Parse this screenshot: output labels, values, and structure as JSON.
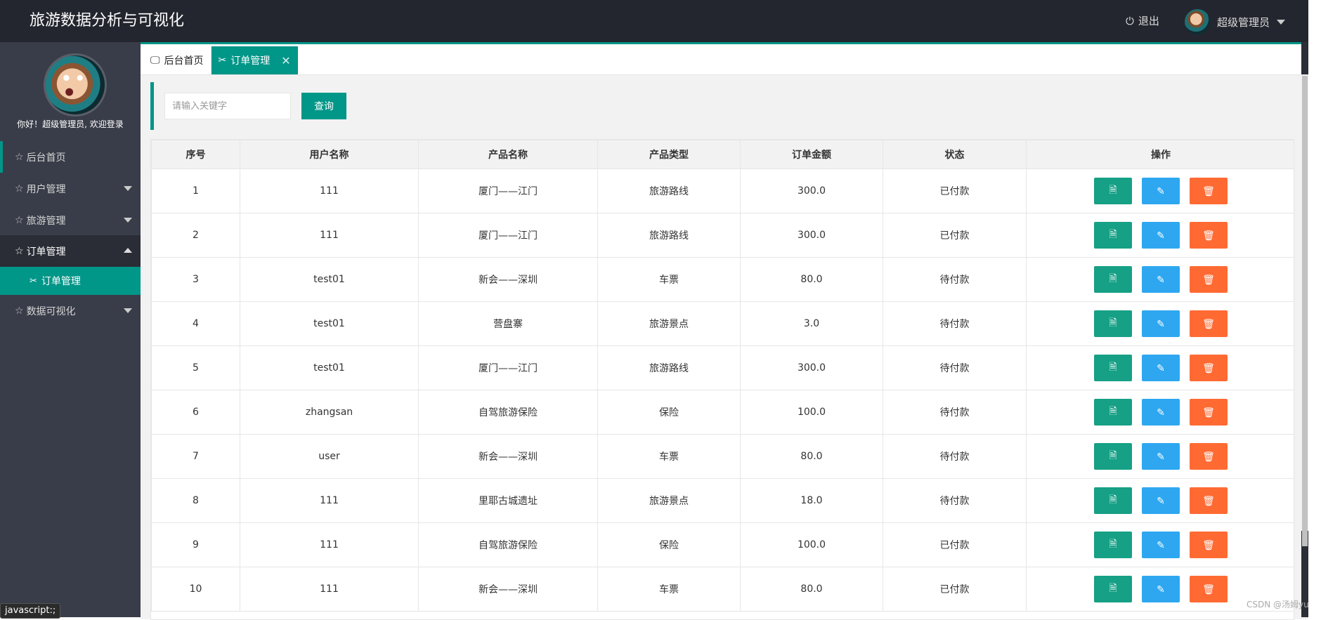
{
  "header": {
    "app_title": "旅游数据分析与可视化",
    "logout_label": "退出",
    "user_label": "超级管理员"
  },
  "sidebar": {
    "welcome": "你好！超级管理员, 欢迎登录",
    "items": [
      {
        "label": "后台首页"
      },
      {
        "label": "用户管理"
      },
      {
        "label": "旅游管理"
      },
      {
        "label": "订单管理"
      },
      {
        "label": "数据可视化"
      }
    ],
    "sub_item": "订单管理"
  },
  "tabs": [
    {
      "label": "后台首页"
    },
    {
      "label": "订单管理"
    }
  ],
  "search": {
    "placeholder": "请输入关键字",
    "button": "查询"
  },
  "table": {
    "headers": [
      "序号",
      "用户名称",
      "产品名称",
      "产品类型",
      "订单金额",
      "状态",
      "操作"
    ],
    "rows": [
      [
        "1",
        "111",
        "厦门——江门",
        "旅游路线",
        "300.0",
        "已付款"
      ],
      [
        "2",
        "111",
        "厦门——江门",
        "旅游路线",
        "300.0",
        "已付款"
      ],
      [
        "3",
        "test01",
        "新会——深圳",
        "车票",
        "80.0",
        "待付款"
      ],
      [
        "4",
        "test01",
        "营盘寨",
        "旅游景点",
        "3.0",
        "待付款"
      ],
      [
        "5",
        "test01",
        "厦门——江门",
        "旅游路线",
        "300.0",
        "待付款"
      ],
      [
        "6",
        "zhangsan",
        "自驾旅游保险",
        "保险",
        "100.0",
        "待付款"
      ],
      [
        "7",
        "user",
        "新会——深圳",
        "车票",
        "80.0",
        "待付款"
      ],
      [
        "8",
        "111",
        "里耶古城遗址",
        "旅游景点",
        "18.0",
        "待付款"
      ],
      [
        "9",
        "111",
        "自驾旅游保险",
        "保险",
        "100.0",
        "已付款"
      ],
      [
        "10",
        "111",
        "新会——深圳",
        "车票",
        "80.0",
        "已付款"
      ]
    ]
  },
  "statusbar": {
    "tip": "javascript:;"
  },
  "watermark": "CSDN @汤姆yu",
  "colors": {
    "accent": "#009688",
    "view": "#16a085",
    "edit": "#2ea7f0",
    "delete": "#ff6a33",
    "header_bg": "#23262e",
    "sidebar_bg": "#393d49"
  }
}
